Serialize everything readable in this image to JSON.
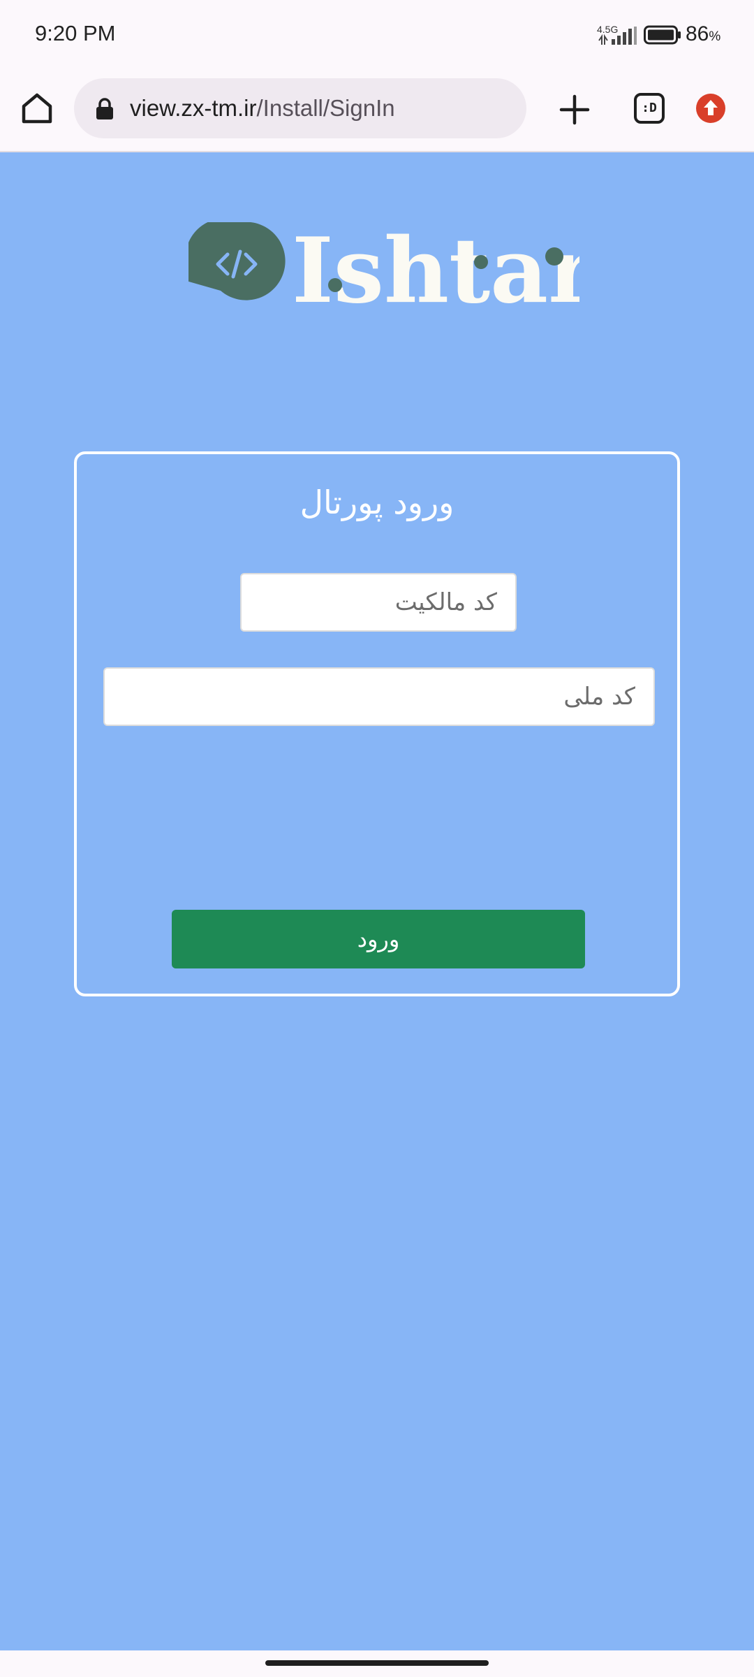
{
  "status_bar": {
    "time": "9:20 PM",
    "network_type": "4.5G",
    "battery_percent": "86",
    "battery_unit": "%"
  },
  "browser": {
    "url_domain": "view.zx-tm.ir",
    "url_path": "/Install/SignIn",
    "tabs_label": ":D",
    "icons": [
      "home-icon",
      "lock-icon",
      "plus-icon",
      "tabs-icon",
      "update-icon"
    ]
  },
  "page": {
    "logo_text": "Ishtar",
    "title": "ورود پورتال",
    "ownership_placeholder": "کد مالکیت",
    "national_code_placeholder": "کد ملی",
    "login_button": "ورود"
  },
  "colors": {
    "page_background": "#87b5f6",
    "login_button": "#1e8a55",
    "logo_bubble": "#4a6e62"
  }
}
